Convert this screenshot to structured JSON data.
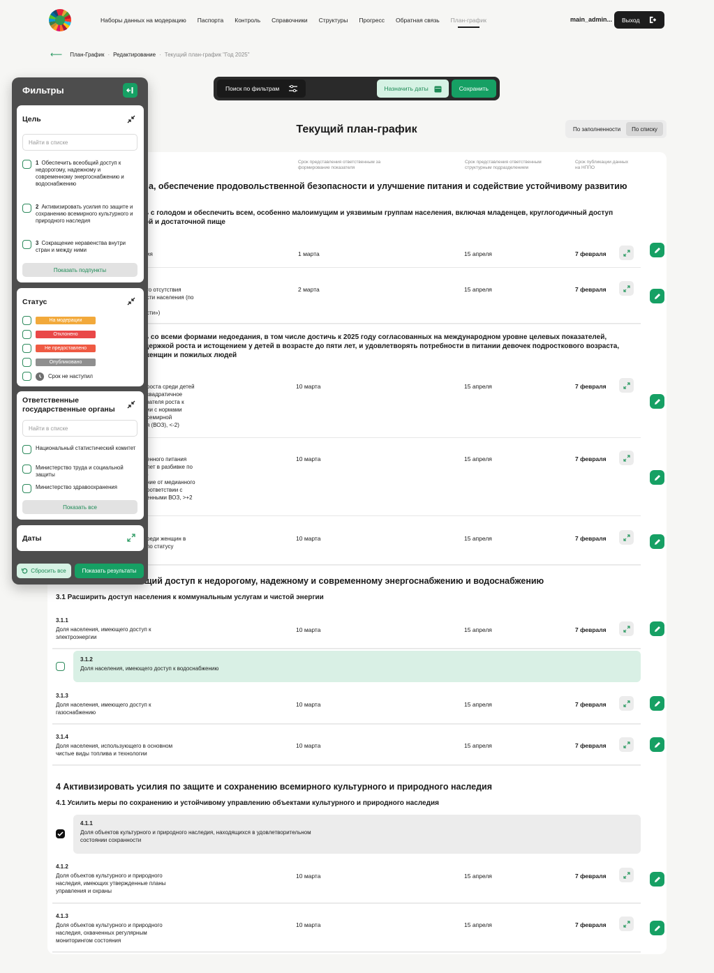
{
  "header": {
    "nav": [
      "Наборы данных на модерацию",
      "Паспорта",
      "Контроль",
      "Справочники",
      "Структуры",
      "Прогресс",
      "Обратная связь",
      "План-график"
    ],
    "user": "main_admin...",
    "exit": "Выход"
  },
  "breadcrumb": [
    "План-График",
    "Редактирование",
    "Текущий план-график \"Год 2025\""
  ],
  "toolbar": {
    "search": "Поиск по фильтрам",
    "assign": "Назначить даты",
    "save": "Сохранить"
  },
  "page_title": "Текущий план-график",
  "view_toggle": [
    "По заполненности",
    "По списку"
  ],
  "columns": {
    "c1": "Срок представления ответственным за формирование показателя",
    "c2": "Срок представления ответственным структурным подразделением",
    "c3": "Срок публикации данных на НППО"
  },
  "sections": {
    "g2": "а, обеспечение продовольственной безопасности и улучшение питания и содействие устойчивому развитию",
    "g2_1a": "ь с голодом и обеспечить всем, особенно малоимущим и уязвимым группам населения, включая младенцев, круглогодичный доступ",
    "g2_1b": "ой и достаточной пище",
    "g2_2a": "ь со всеми формами недоедания, в том числе достичь к 2025 году согласованных на международном уровне целевых показателей,",
    "g2_2b": "держкой роста и истощением у детей в возрасте до пяти лет, и удовлетворять потребности в питании девочек подросткового возраста,",
    "g2_2c": "женщин и пожилых людей",
    "g3": "щий доступ к недорогому, надежному и современному энергоснабжению и водоснабжению",
    "g3_1": "3.1 Расширить доступ населения к коммунальным услугам и чистой энергии",
    "g4": "4 Активизировать усилия по защите и сохранению всемирного культурного и природного наследия",
    "g4_1": "4.1  Усилить меры по сохранению и устойчивому управлению объектами культурного и природного наследия"
  },
  "rows": [
    {
      "code": "",
      "name": "ия",
      "d1": "1 марта",
      "d2": "15 апреля",
      "d3": "7 февраля"
    },
    {
      "code": "",
      "name": "го отсутствия\nсти населения (по\n\nсти»)",
      "d1": "2 марта",
      "d2": "15 апреля",
      "d3": "7 февраля"
    },
    {
      "code": "",
      "name": " роста среди детей\nквадратичное\nзателя роста к\nии с нормами\nсемирной\nя (ВОЗ), <-2)",
      "d1": "10 марта",
      "d2": "15 апреля",
      "d3": "7 февраля"
    },
    {
      "code": "",
      "name": "енного питания\n лет в разбивке по\n)\nние от медианного\nоответствии с\nенными ВОЗ, >+2",
      "d1": "10 марта",
      "d2": "15 апреля",
      "d3": "7 февраля"
    },
    {
      "code": "",
      "name": "реди женщин в\nпо статусу",
      "d1": "10 марта",
      "d2": "15 апреля",
      "d3": "7 февраля"
    },
    {
      "code": "3.1.1",
      "name": "Доля населения, имеющего доступ к\nэлектроэнергии",
      "d1": "10 марта",
      "d2": "15 апреля",
      "d3": "7 февраля"
    },
    {
      "code": "3.1.2",
      "name": "Доля населения, имеющего доступ к водоснабжению"
    },
    {
      "code": "3.1.3",
      "name": "Доля населения, имеющего доступ к\nгазоснабжению",
      "d1": "10 марта",
      "d2": "15 апреля",
      "d3": "7 февраля"
    },
    {
      "code": "3.1.4",
      "name": "Доля населения, использующего в основном\nчистые виды топлива и технологии",
      "d1": "10 марта",
      "d2": "15 апреля",
      "d3": "7 февраля"
    },
    {
      "code": "4.1.1",
      "name": "Доля объектов культурного и природного наследия, находящихся в удовлетворительном\nсостоянии сохранности"
    },
    {
      "code": "4.1.2",
      "name": "Доля объектов культурного и природного\nнаследия, имеющих утвержденные планы\nуправления и охраны",
      "d1": "10 марта",
      "d2": "15 апреля",
      "d3": "7 февраля"
    },
    {
      "code": "4.1.3",
      "name": "Доля объектов культурного и природного\nнаследия, охваченных регулярным\nмониторингом состояния",
      "d1": "10 марта",
      "d2": "15 апреля",
      "d3": "7 февраля"
    }
  ],
  "filters": {
    "title": "Фильтры",
    "goal": {
      "title": "Цель",
      "search": "Найти в списке",
      "items": [
        {
          "num": "1",
          "label": "Обеспечить всеобщий доступ к недорогому, надежному и современному энергоснабжению и водоснабжению"
        },
        {
          "num": "2",
          "label": "Активизировать усилия по защите и сохранению всемирного культурного и природного наследия"
        },
        {
          "num": "3",
          "label": "Сокращение неравенства внутри стран и между ними"
        }
      ],
      "button": "Показать подпункты"
    },
    "status": {
      "title": "Статус",
      "items": [
        {
          "label": "На модерации",
          "color": "#f2a93b"
        },
        {
          "label": "Отклонено",
          "color": "#e94848"
        },
        {
          "label": "Не предоставлено",
          "color": "#ef5a43"
        },
        {
          "label": "Опубликовано",
          "color": "#8f8f8f"
        }
      ],
      "not_due": "Срок не наступил"
    },
    "organs": {
      "title": "Ответственные государственные органы",
      "search": "Найти в списке",
      "items": [
        "Национальный статистический комитет",
        "Министерство труда и социальной защиты",
        "Министерство здравоохранения"
      ],
      "button": "Показать все"
    },
    "dates": {
      "title": "Даты"
    },
    "reset": "Сбросить все",
    "show": "Показать результаты"
  }
}
